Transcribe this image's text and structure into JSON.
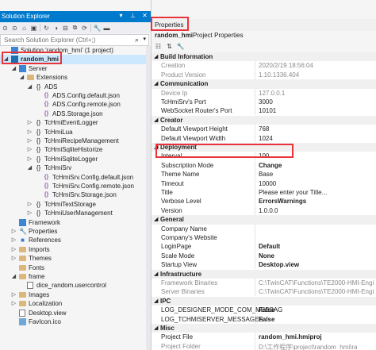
{
  "solution_explorer": {
    "title": "Solution Explorer",
    "search_placeholder": "Search Solution Explorer (Ctrl+;)",
    "tree": [
      {
        "label": "Solution 'random_hmi' (1 project)",
        "icon": "solution-icon",
        "indent": 0,
        "arrow": ""
      },
      {
        "label": "random_hmi",
        "icon": "project-icon",
        "indent": 0,
        "arrow": "▲",
        "selected": true
      },
      {
        "label": "Server",
        "icon": "server-icon",
        "indent": 1,
        "arrow": "▲"
      },
      {
        "label": "Extensions",
        "icon": "folder-icon",
        "indent": 2,
        "arrow": "▲"
      },
      {
        "label": "ADS",
        "icon": "braces-icon",
        "indent": 3,
        "arrow": "▲"
      },
      {
        "label": "ADS.Config.default.json",
        "icon": "json-icon",
        "indent": 4,
        "arrow": ""
      },
      {
        "label": "ADS.Config.remote.json",
        "icon": "json-icon",
        "indent": 4,
        "arrow": ""
      },
      {
        "label": "ADS.Storage.json",
        "icon": "json-icon",
        "indent": 4,
        "arrow": ""
      },
      {
        "label": "TcHmiEventLogger",
        "icon": "braces-icon",
        "indent": 3,
        "arrow": "▶"
      },
      {
        "label": "TcHmiLua",
        "icon": "braces-icon",
        "indent": 3,
        "arrow": "▶"
      },
      {
        "label": "TcHmiRecipeManagement",
        "icon": "braces-icon",
        "indent": 3,
        "arrow": "▶"
      },
      {
        "label": "TcHmiSqliteHistorize",
        "icon": "braces-icon",
        "indent": 3,
        "arrow": "▶"
      },
      {
        "label": "TcHmiSqliteLogger",
        "icon": "braces-icon",
        "indent": 3,
        "arrow": "▶"
      },
      {
        "label": "TcHmiSrv",
        "icon": "braces-icon",
        "indent": 3,
        "arrow": "▲"
      },
      {
        "label": "TcHmiSrv.Config.default.json",
        "icon": "json-icon",
        "indent": 4,
        "arrow": ""
      },
      {
        "label": "TcHmiSrv.Config.remote.json",
        "icon": "json-icon",
        "indent": 4,
        "arrow": ""
      },
      {
        "label": "TcHmiSrv.Storage.json",
        "icon": "json-icon",
        "indent": 4,
        "arrow": ""
      },
      {
        "label": "TcHmiTextStorage",
        "icon": "braces-icon",
        "indent": 3,
        "arrow": "▶"
      },
      {
        "label": "TcHmiUserManagement",
        "icon": "braces-icon",
        "indent": 3,
        "arrow": "▶"
      },
      {
        "label": "Framework",
        "icon": "framework-icon",
        "indent": 1,
        "arrow": ""
      },
      {
        "label": "Properties",
        "icon": "wrench-icon",
        "indent": 1,
        "arrow": "▶"
      },
      {
        "label": "References",
        "icon": "references-icon",
        "indent": 1,
        "arrow": "▶"
      },
      {
        "label": "Imports",
        "icon": "folder-icon",
        "indent": 1,
        "arrow": "▶"
      },
      {
        "label": "Themes",
        "icon": "folder-icon",
        "indent": 1,
        "arrow": "▶"
      },
      {
        "label": "Fonts",
        "icon": "folder-icon",
        "indent": 1,
        "arrow": ""
      },
      {
        "label": "frame",
        "icon": "folder-icon",
        "indent": 1,
        "arrow": "▲"
      },
      {
        "label": "dice_random.usercontrol",
        "icon": "file-icon",
        "indent": 2,
        "arrow": ""
      },
      {
        "label": "Images",
        "icon": "folder-icon",
        "indent": 1,
        "arrow": "▶"
      },
      {
        "label": "Localization",
        "icon": "folder-icon",
        "indent": 1,
        "arrow": "▶"
      },
      {
        "label": "Desktop.view",
        "icon": "file-icon",
        "indent": 1,
        "arrow": ""
      },
      {
        "label": "FavIcon.ico",
        "icon": "image-icon",
        "indent": 1,
        "arrow": ""
      }
    ]
  },
  "properties": {
    "title": "Properties",
    "object_name": "random_hmi",
    "object_kind": "Project Properties",
    "rows": [
      {
        "type": "cat",
        "label": "Build Information"
      },
      {
        "type": "item",
        "key": "Creation",
        "value": "2020/2/19 18:56:04",
        "dim": true
      },
      {
        "type": "item",
        "key": "Product Version",
        "value": "1.10.1336.404",
        "dim": true
      },
      {
        "type": "cat",
        "label": "Communication"
      },
      {
        "type": "item",
        "key": "Device Ip",
        "value": "127.0.0.1",
        "dim": true
      },
      {
        "type": "item",
        "key": "TcHmiSrv's Port",
        "value": "3000"
      },
      {
        "type": "item",
        "key": "WebSocket Router's Port",
        "value": "10101"
      },
      {
        "type": "cat",
        "label": "Creator"
      },
      {
        "type": "item",
        "key": "Default Viewport Height",
        "value": "768"
      },
      {
        "type": "item",
        "key": "Default Viewport Width",
        "value": "1024"
      },
      {
        "type": "cat",
        "label": "Deployment"
      },
      {
        "type": "item",
        "key": "Interval",
        "value": "100"
      },
      {
        "type": "item",
        "key": "Subscription Mode",
        "value": "Change",
        "bold": true
      },
      {
        "type": "item",
        "key": "Theme Name",
        "value": "Base"
      },
      {
        "type": "item",
        "key": "Timeout",
        "value": "10000"
      },
      {
        "type": "item",
        "key": "Title",
        "value": "Please enter your Title..."
      },
      {
        "type": "item",
        "key": "Verbose Level",
        "value": "ErrorsWarnings",
        "bold": true
      },
      {
        "type": "item",
        "key": "Version",
        "value": "1.0.0.0"
      },
      {
        "type": "cat",
        "label": "General"
      },
      {
        "type": "item",
        "key": "Company Name",
        "value": ""
      },
      {
        "type": "item",
        "key": "Company's Website",
        "value": ""
      },
      {
        "type": "item",
        "key": "LoginPage",
        "value": "Default",
        "bold": true
      },
      {
        "type": "item",
        "key": "Scale Mode",
        "value": "None",
        "bold": true
      },
      {
        "type": "item",
        "key": "Startup View",
        "value": "Desktop.view",
        "bold": true
      },
      {
        "type": "cat",
        "label": "Infrastructure"
      },
      {
        "type": "item",
        "key": "Framework Binaries",
        "value": "C:\\TwinCAT\\Functions\\TE2000-HMI-Engi",
        "dim": true
      },
      {
        "type": "item",
        "key": "Server Binaries",
        "value": "C:\\TwinCAT\\Functions\\TE2000-HMI-Engi",
        "dim": true
      },
      {
        "type": "cat",
        "label": "IPC"
      },
      {
        "type": "item",
        "key": "LOG_DESIGNER_MODE_COM_MESSAG",
        "value": "False",
        "bold": true
      },
      {
        "type": "item",
        "key": "LOG_TCHMISERVER_MESSAGES",
        "value": "False",
        "bold": true
      },
      {
        "type": "cat",
        "label": "Misc"
      },
      {
        "type": "item",
        "key": "Project File",
        "value": "random_hmi.hmiproj",
        "bold": true
      },
      {
        "type": "item",
        "key": "Project Folder",
        "value": "D:\\工作程序\\project\\random_hmi\\ra",
        "dim": true
      },
      {
        "type": "cat",
        "label": "Region and Language"
      }
    ]
  },
  "colors": {
    "accent": "#007acc",
    "highlight_box": "#e8333a",
    "selection": "#cce8ff"
  }
}
